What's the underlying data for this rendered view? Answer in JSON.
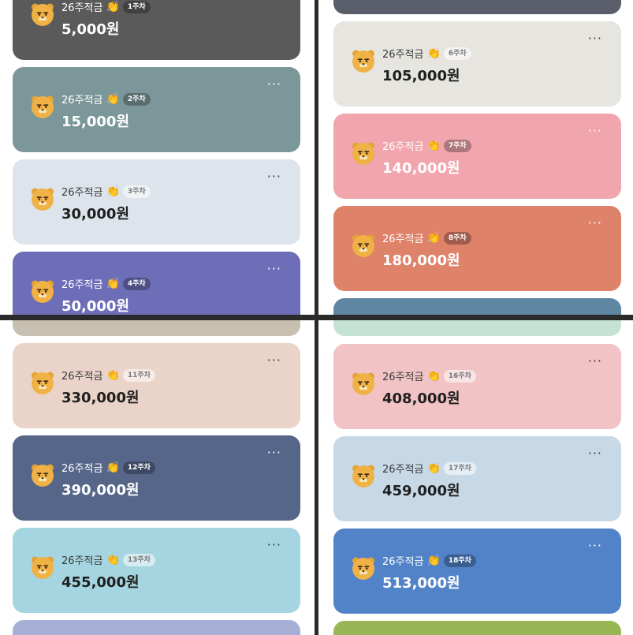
{
  "bear_icon": "ryan-bear-icon",
  "clap_icon": "👏",
  "more_label": "···",
  "colors": {
    "gray": "#5a5a5a",
    "teal_gray": "#7c9799",
    "light_blue": "#dde4ec",
    "purple": "#6e6db8",
    "beige_strip": "#c7c0b0",
    "ivory": "#e6e5e0",
    "pink": "#f1a5ad",
    "salmon": "#df826a",
    "steel_blue": "#5f86a3",
    "mint": "#c5e3d4",
    "peach": "#ead3c9",
    "slate": "#566689",
    "aqua": "#a5d5e0",
    "periwinkle": "#a6b0d6",
    "light_pink": "#f1c3c5",
    "pale_blue": "#c7d9e7",
    "blue": "#5283c8",
    "green": "#98b653"
  },
  "panels": {
    "top_left": {
      "cards": [
        {
          "title": "26주적금",
          "week": "1주차",
          "amount": "5,000원"
        },
        {
          "title": "26주적금",
          "week": "2주차",
          "amount": "15,000원"
        },
        {
          "title": "26주적금",
          "week": "3주차",
          "amount": "30,000원"
        },
        {
          "title": "26주적금",
          "week": "4주차",
          "amount": "50,000원"
        }
      ]
    },
    "top_right": {
      "cards": [
        {
          "title": "26주적금",
          "week": "6주차",
          "amount": "105,000원"
        },
        {
          "title": "26주적금",
          "week": "7주차",
          "amount": "140,000원"
        },
        {
          "title": "26주적금",
          "week": "8주차",
          "amount": "180,000원"
        }
      ]
    },
    "bottom_left": {
      "cards": [
        {
          "title": "26주적금",
          "week": "11주차",
          "amount": "330,000원"
        },
        {
          "title": "26주적금",
          "week": "12주차",
          "amount": "390,000원"
        },
        {
          "title": "26주적금",
          "week": "13주차",
          "amount": "455,000원"
        }
      ]
    },
    "bottom_right": {
      "cards": [
        {
          "title": "26주적금",
          "week": "16주차",
          "amount": "408,000원"
        },
        {
          "title": "26주적금",
          "week": "17주차",
          "amount": "459,000원"
        },
        {
          "title": "26주적금",
          "week": "18주차",
          "amount": "513,000원"
        }
      ]
    }
  }
}
